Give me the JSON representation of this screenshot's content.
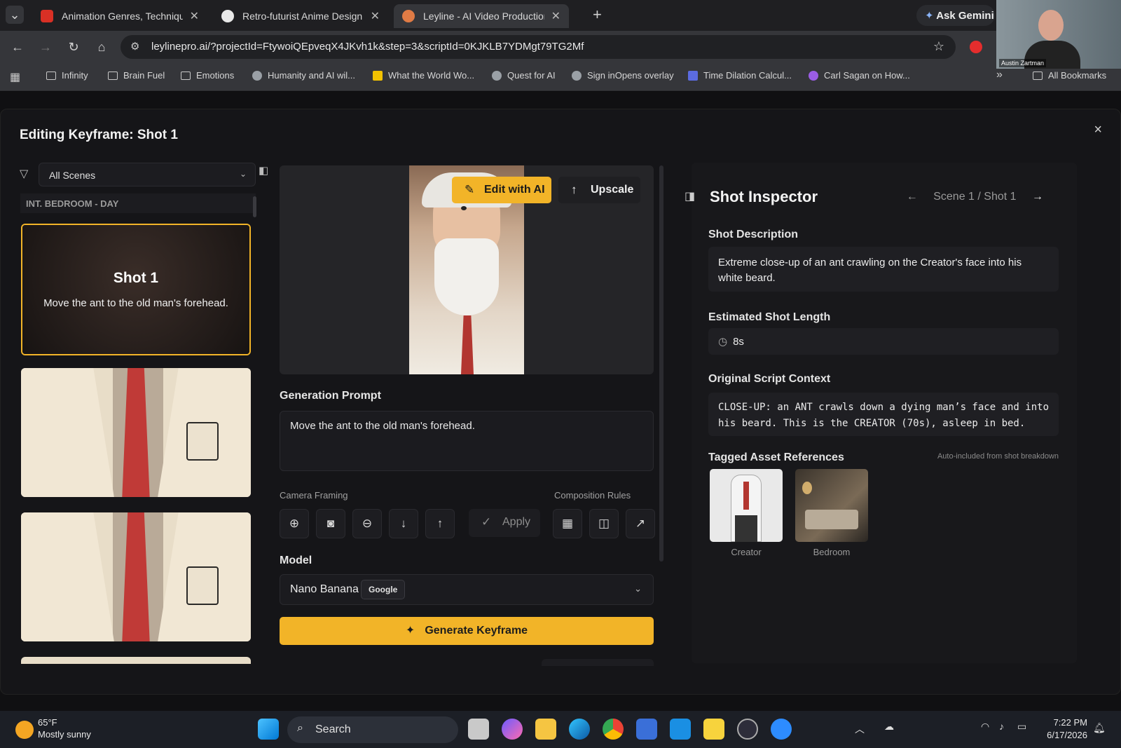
{
  "browser": {
    "tabs": [
      {
        "title": "Animation Genres, Technique a",
        "color": "#d93025"
      },
      {
        "title": "Retro-futurist Anime Design",
        "color": "#e8e8e8"
      },
      {
        "title": "Leyline - AI Video Production P",
        "color": "#e07b45"
      }
    ],
    "new_tab": "+",
    "ask_gemini": "Ask Gemini",
    "url": "leylinepro.ai/?projectId=FtywoiQEpveqX4JKvh1k&step=3&scriptId=0KJKLB7YDMgt79TG2Mf",
    "bookmarks": [
      "Infinity",
      "Brain Fuel",
      "Emotions",
      "Humanity and AI wil...",
      "What the World Wo...",
      "Quest for AI",
      "Sign inOpens overlay",
      "Time Dilation Calcul...",
      "Carl Sagan on How..."
    ],
    "all_bookmarks": "All Bookmarks",
    "webcam_name": "Austin Zartman"
  },
  "modal": {
    "title": "Editing Keyframe: Shot 1",
    "close": "×"
  },
  "left": {
    "filter_value": "All Scenes",
    "scene_header": "INT. BEDROOM - DAY",
    "shot1_title": "Shot 1",
    "shot1_desc": "Move the ant to the old man's forehead."
  },
  "center": {
    "edit_ai": "Edit with AI",
    "upscale": "Upscale",
    "gen_label": "Generation Prompt",
    "prompt": "Move the ant to the old man's forehead.",
    "camera_label": "Camera Framing",
    "composition_label": "Composition Rules",
    "apply": "Apply",
    "model_label": "Model",
    "model_value": "Nano Banana",
    "model_badge": "Google",
    "generate": "Generate Keyframe"
  },
  "inspector": {
    "title": "Shot Inspector",
    "nav": "Scene 1 / Shot 1",
    "desc_label": "Shot Description",
    "desc": "Extreme close-up of an ant crawling on the Creator's face into his white beard.",
    "len_label": "Estimated Shot Length",
    "len": "8s",
    "ctx_label": "Original Script Context",
    "ctx": "CLOSE-UP: an ANT crawls down a dying man’s face and into his beard. This is the CREATOR (70s), asleep in bed.",
    "assets_label": "Tagged Asset References",
    "assets_note": "Auto-included from shot breakdown",
    "assets": [
      "Creator",
      "Bedroom"
    ]
  },
  "taskbar": {
    "temp": "65°F",
    "weather": "Mostly sunny",
    "search": "Search",
    "time": "7:22 PM",
    "date": "6/17/2026"
  },
  "colors": {
    "accent": "#f2b428",
    "bg": "#151518"
  }
}
